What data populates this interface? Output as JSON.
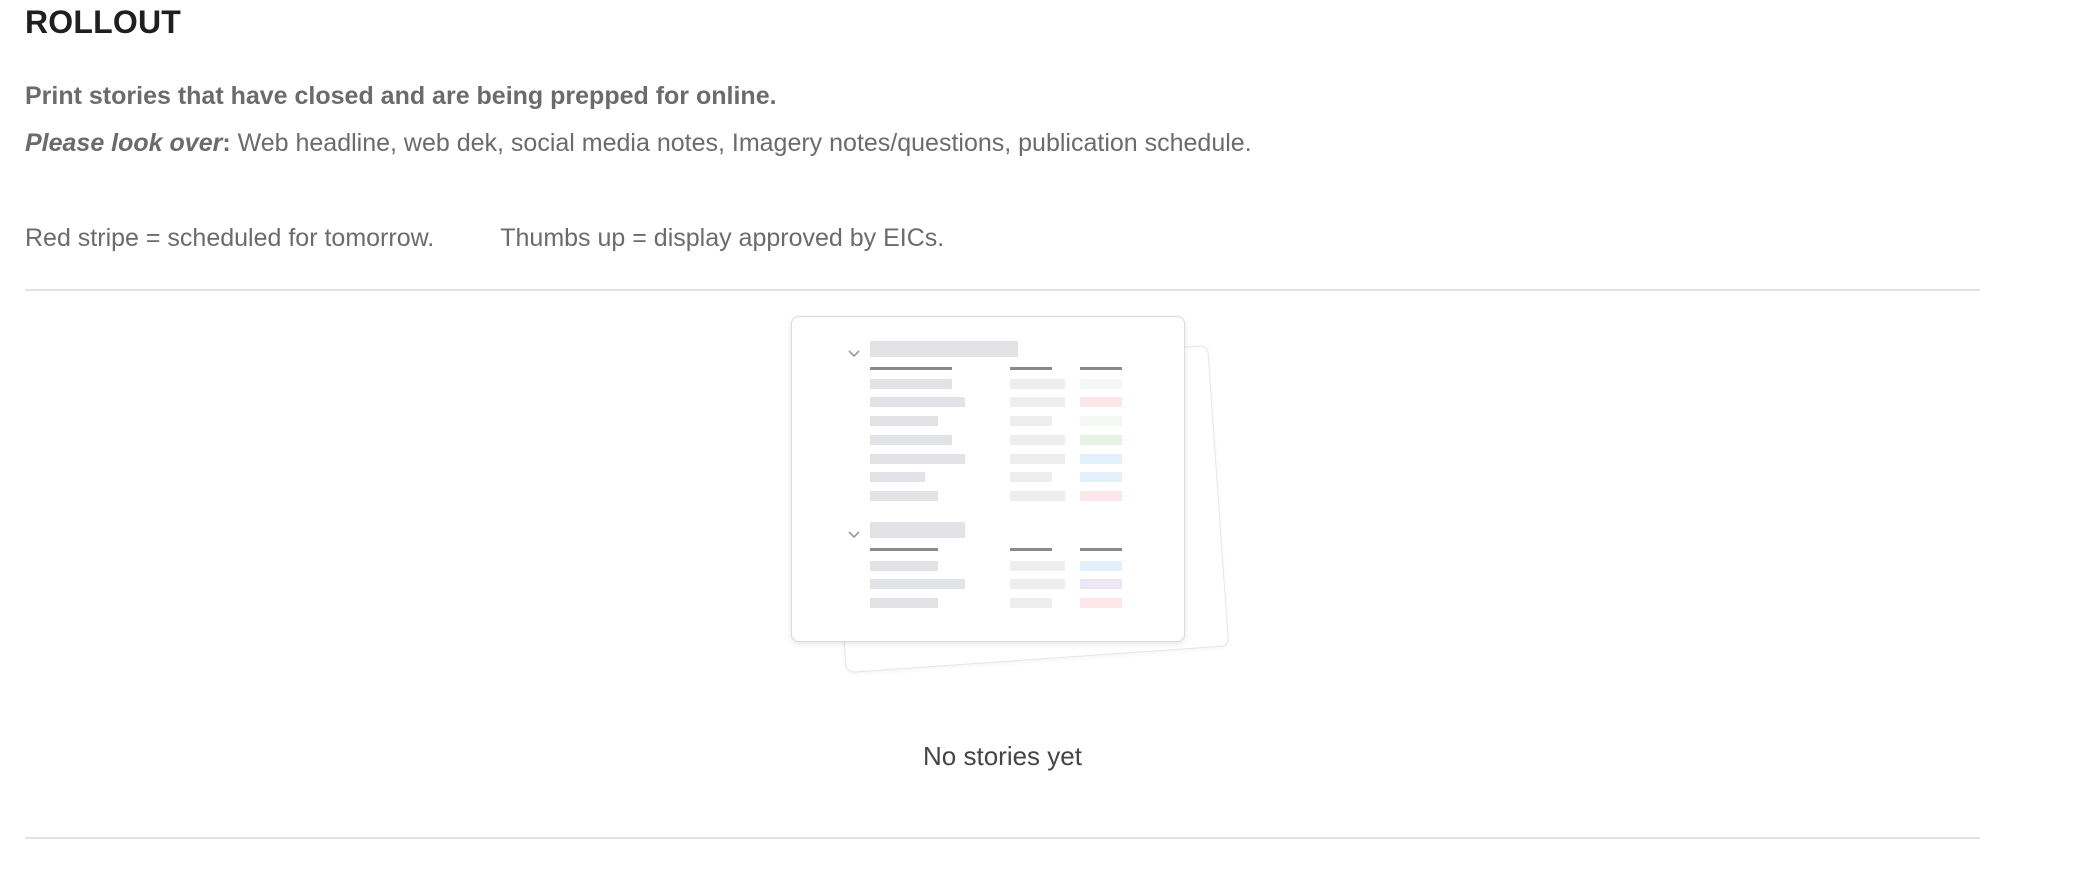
{
  "section": {
    "title": "ROLLOUT",
    "intro": "Print stories that have closed and are being prepped for online.",
    "look_over_label": "Please look over",
    "look_over_colon": ":",
    "look_over_text": " Web headline, web dek, social media notes, Imagery notes/questions, publication schedule.",
    "legend_red": "Red stripe = scheduled for tomorrow.",
    "legend_thumbs": "Thumbs up = display approved by EICs."
  },
  "empty_state": {
    "message": "No stories yet",
    "illustration": "empty-table-illustration",
    "placeholder_colors": [
      "#e1e3e6",
      "#eeeeee",
      "#898a8c",
      "#f3f8f2",
      "#fde6ea",
      "#e6f2e6",
      "#e1f0fb",
      "#ece6f6"
    ]
  }
}
